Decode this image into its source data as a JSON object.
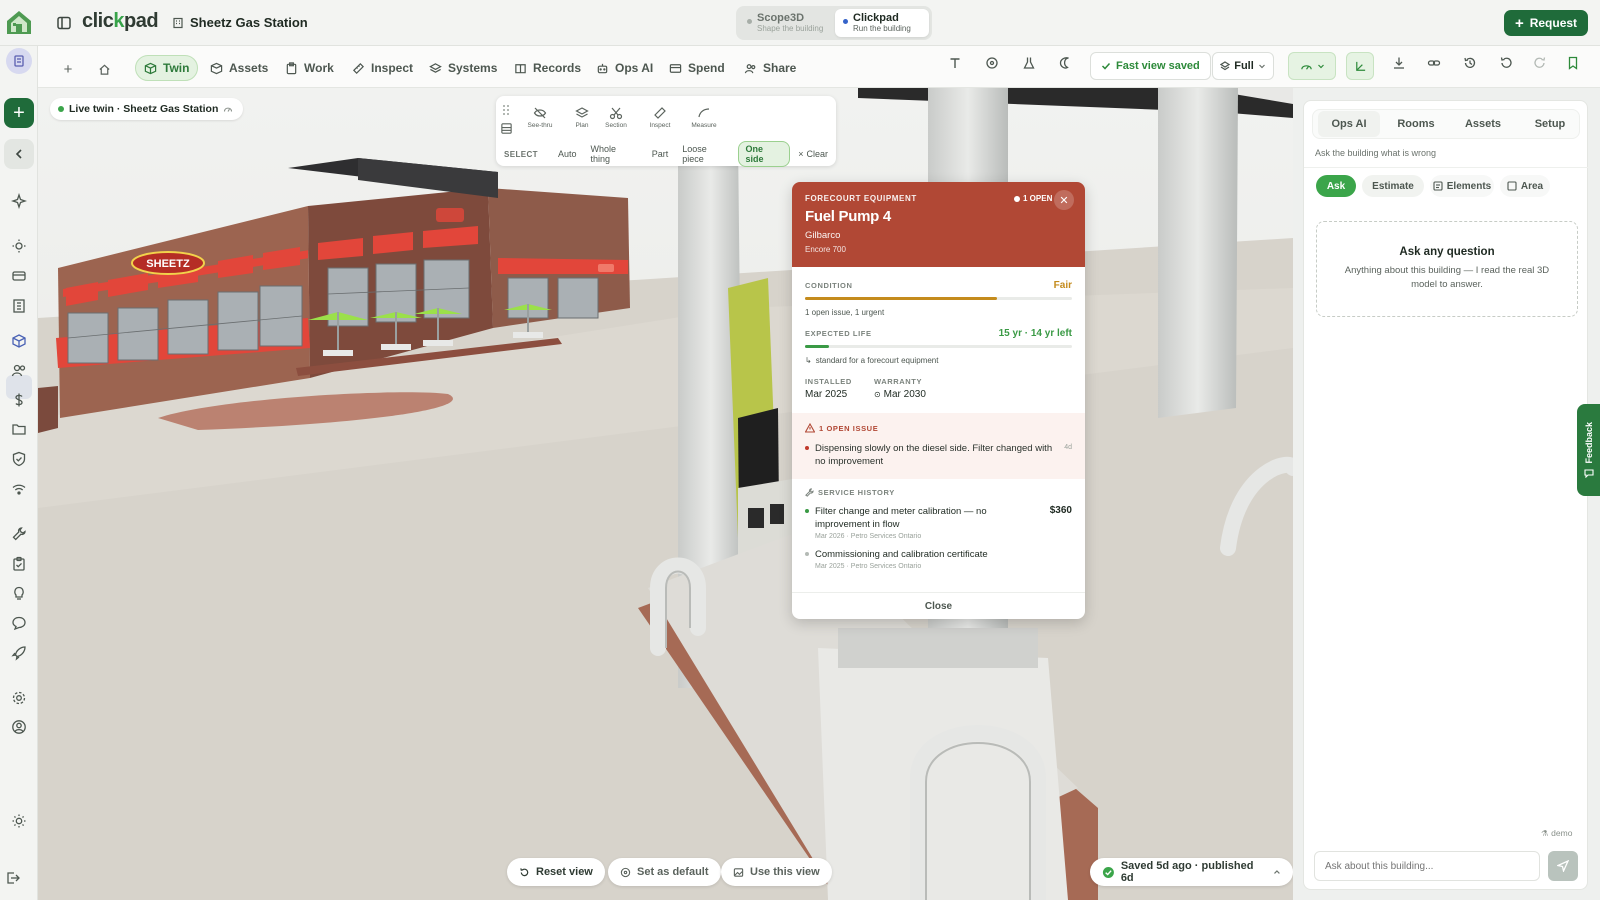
{
  "app": {
    "brand_main": "clickpad",
    "building_name": "Sheetz Gas Station",
    "modes": [
      {
        "title": "Scope3D",
        "subtitle": "Shape the building",
        "active": false
      },
      {
        "title": "Clickpad",
        "subtitle": "Run the building",
        "active": true
      }
    ],
    "request_label": "Request"
  },
  "icons": {
    "logo": "clickpad-house-logo",
    "rail": [
      "avatar-icon",
      "add-icon",
      "chevron-left-icon",
      "sparkle-icon",
      "sun-icon",
      "cards-icon",
      "building-icon",
      "cube-icon",
      "people-icon",
      "dollar-icon",
      "folder-icon",
      "shield-icon",
      "wifi-icon",
      "wrench-icon",
      "clipboard-icon",
      "bulb-icon",
      "chat-icon",
      "rocket-icon",
      "gear-icon",
      "user-circle-icon",
      "brightness-icon",
      "logout-icon"
    ]
  },
  "nav": {
    "tabs": [
      {
        "label": "Twin",
        "icon": "cube-icon",
        "active": true
      },
      {
        "label": "Assets",
        "icon": "box-icon"
      },
      {
        "label": "Work",
        "icon": "clipboard-icon"
      },
      {
        "label": "Inspect",
        "icon": "ruler-icon"
      },
      {
        "label": "Systems",
        "icon": "layers-icon"
      },
      {
        "label": "Records",
        "icon": "book-icon"
      },
      {
        "label": "Ops AI",
        "icon": "robot-icon"
      },
      {
        "label": "Spend",
        "icon": "card-icon"
      },
      {
        "label": "Share",
        "icon": "users-icon"
      }
    ],
    "fast_view_label": "Fast view saved",
    "view_mode": "Full"
  },
  "viewport": {
    "live_label": "Live twin · Sheetz Gas Station",
    "tools": [
      "See-thru",
      "Plan",
      "Section",
      "Inspect",
      "Measure"
    ],
    "select_label": "SELECT",
    "select_options": [
      "Auto",
      "Whole thing",
      "Part",
      "Loose piece",
      "One side"
    ],
    "select_active": "One side",
    "clear_label": "Clear",
    "store_sign": "SHEETZ",
    "colors": {
      "awning": "#e2463a",
      "brick": "#8c5a4a",
      "umbrella": "#9be04a",
      "ground": "#d8d4cc"
    }
  },
  "card": {
    "category": "FORECOURT EQUIPMENT",
    "open_badge": "1 OPEN",
    "title": "Fuel Pump 4",
    "make": "Gilbarco",
    "model": "Encore 700",
    "header_color": "#b14835",
    "condition_label": "CONDITION",
    "condition_value": "Fair",
    "condition_level": 0.72,
    "condition_note": "1 open issue, 1 urgent",
    "life_label": "EXPECTED LIFE",
    "life_value": "15 yr · 14 yr left",
    "life_level": 0.09,
    "life_note": "standard for a forecourt equipment",
    "installed_label": "INSTALLED",
    "installed_value": "Mar 2025",
    "warranty_label": "WARRANTY",
    "warranty_value": "Mar 2030",
    "issue_header": "1 OPEN ISSUE",
    "issue_text": "Dispensing slowly on the diesel side. Filter changed with no improvement",
    "issue_age": "4d",
    "history_header": "SERVICE HISTORY",
    "history": [
      {
        "title": "Filter change and meter calibration — no improvement in flow",
        "meta": "Mar 2026 · Petro Services Ontario",
        "cost": "$360"
      },
      {
        "title": "Commissioning and calibration certificate",
        "meta": "Mar 2025 · Petro Services Ontario",
        "cost": ""
      }
    ],
    "close_label": "Close"
  },
  "bottom": {
    "reset_label": "Reset view",
    "default_label": "Set as default",
    "use_label": "Use this view",
    "saved_label": "Saved 5d ago · published 6d"
  },
  "right_panel": {
    "tabs": [
      "Ops AI",
      "Rooms",
      "Assets",
      "Setup"
    ],
    "active_tab": "Ops AI",
    "hint": "Ask the building what is wrong",
    "chips": [
      "Ask",
      "Estimate",
      "Elements",
      "Area"
    ],
    "ask_title": "Ask any question",
    "ask_body": "Anything about this building — I read the real 3D model to answer.",
    "user_label": "demo",
    "input_placeholder": "Ask about this building...",
    "feedback_label": "Feedback"
  },
  "rail": {
    "badge": "dx"
  }
}
